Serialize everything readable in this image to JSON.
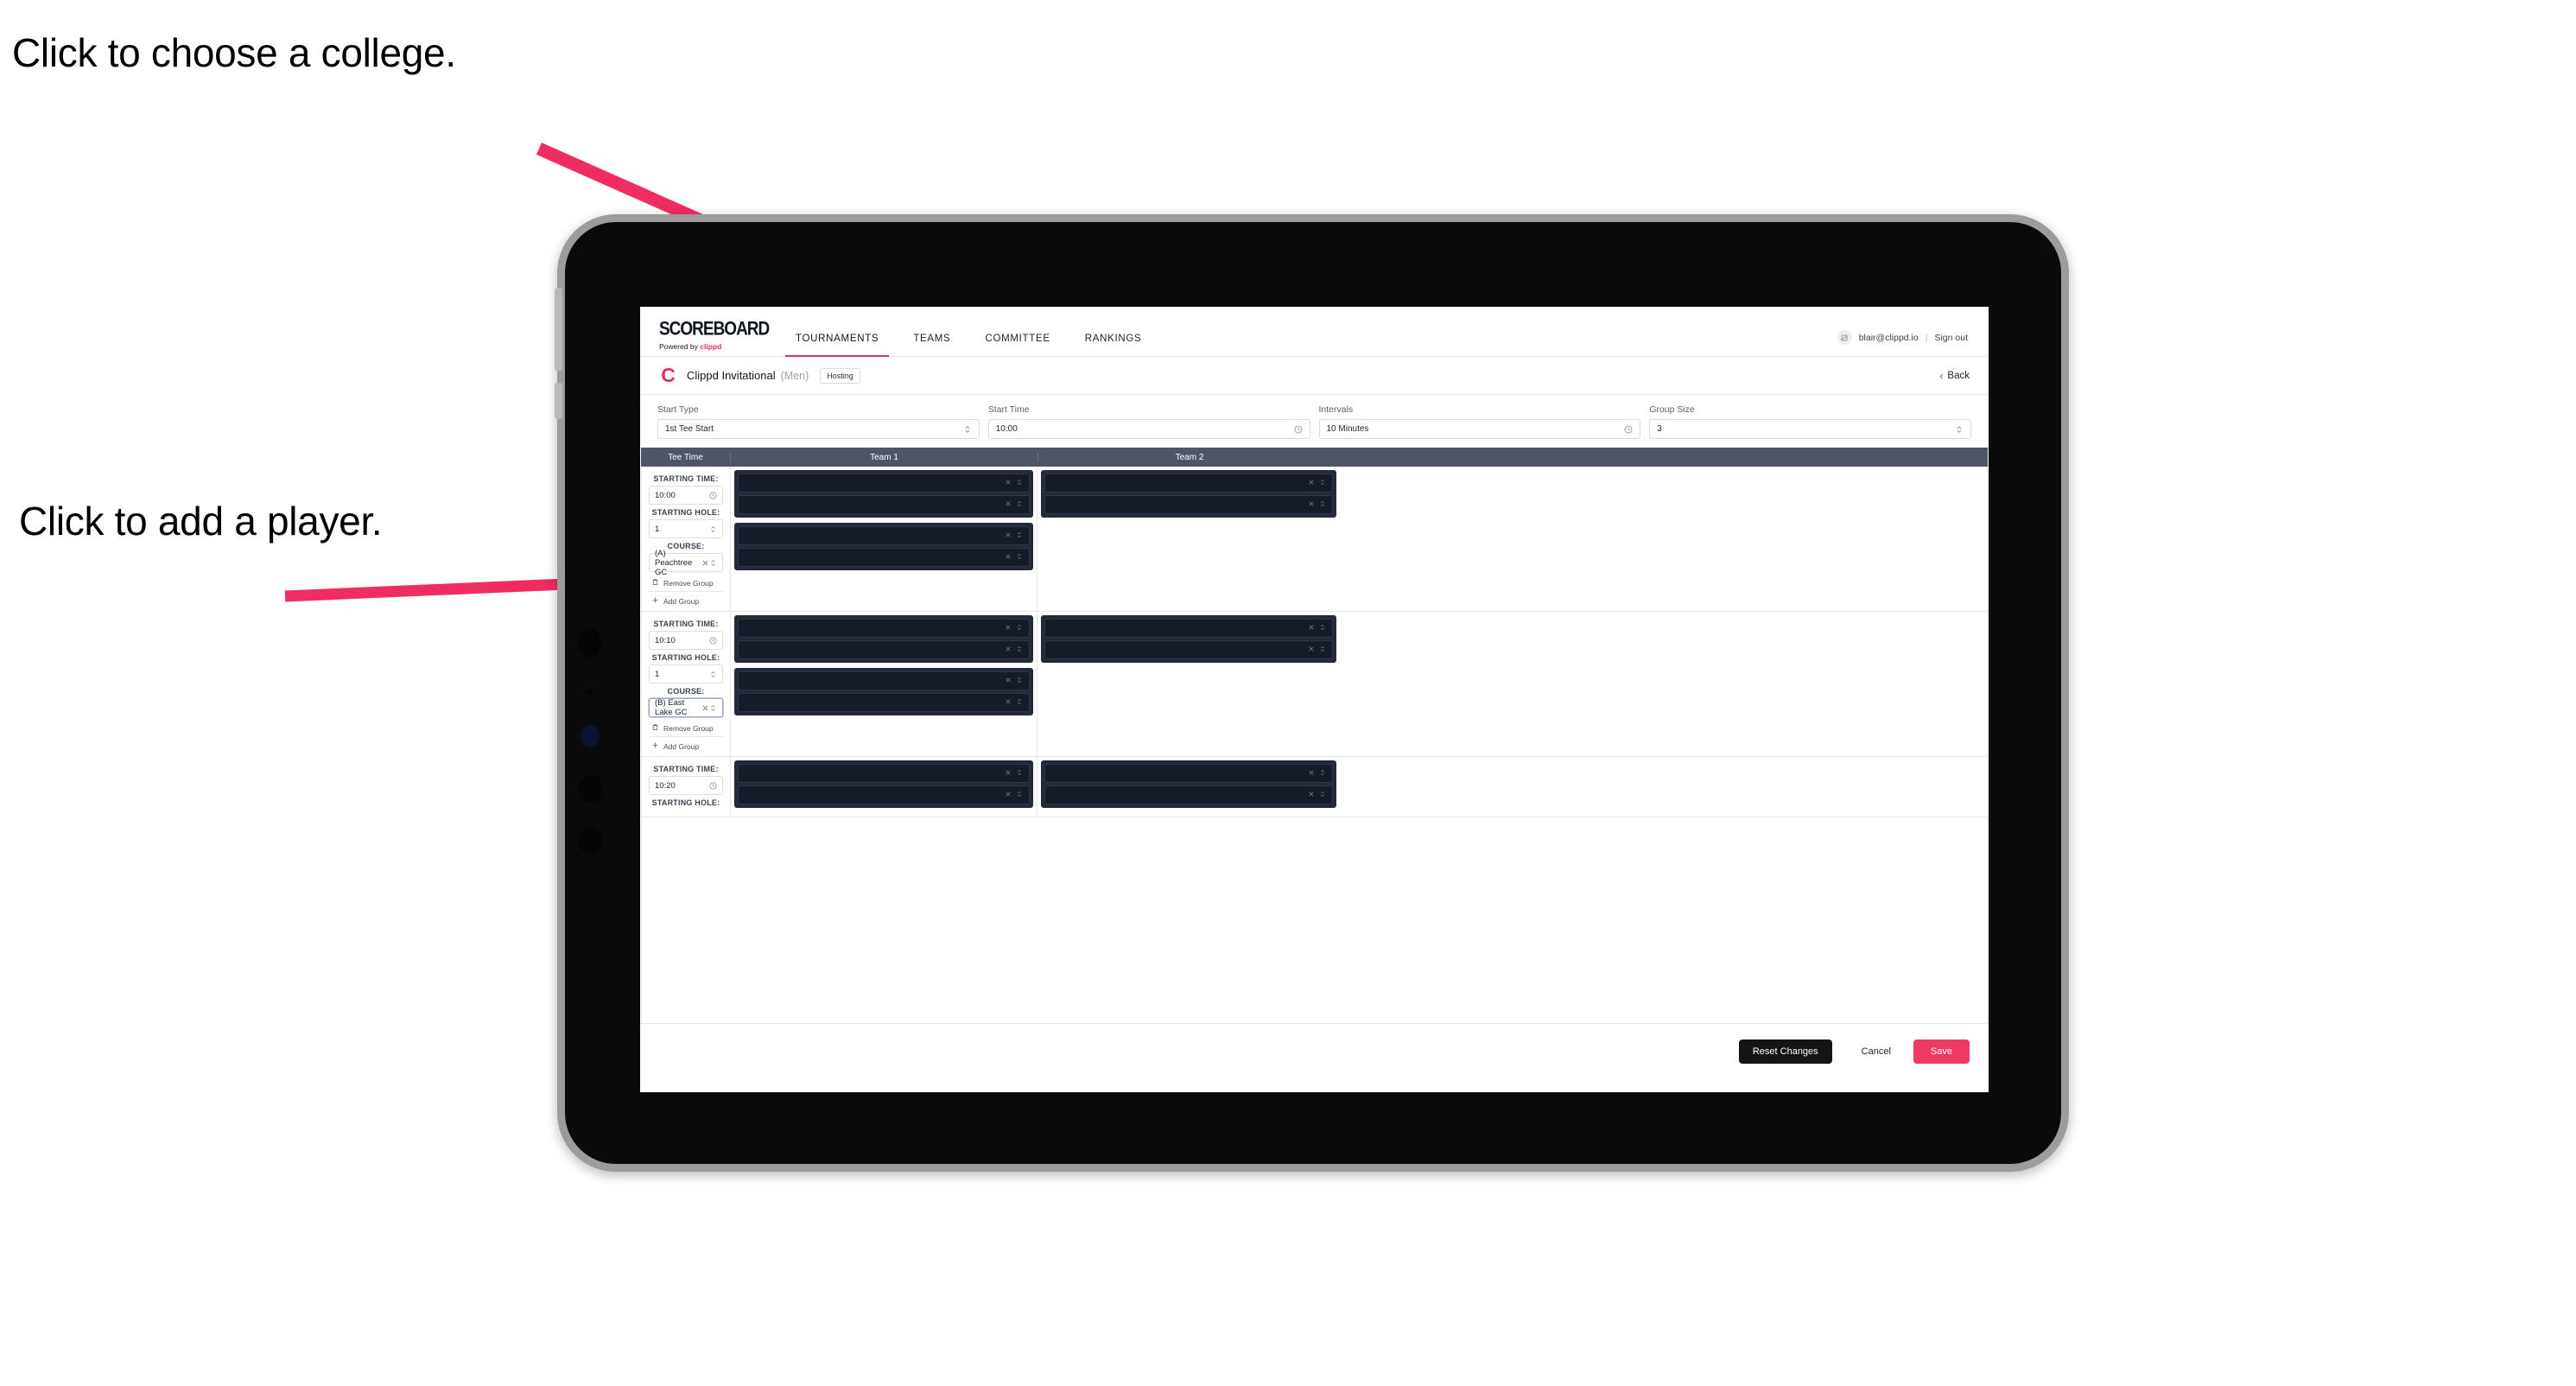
{
  "annotations": {
    "college": "Click to choose a college.",
    "player": "Click to add a player.",
    "arrow_color": "#ef2d63"
  },
  "app": {
    "brand": {
      "name": "SCOREBOARD",
      "tagline_prefix": "Powered by ",
      "tagline_brand": "clippd"
    },
    "nav": [
      {
        "label": "TOURNAMENTS",
        "active": true
      },
      {
        "label": "TEAMS",
        "active": false
      },
      {
        "label": "COMMITTEE",
        "active": false
      },
      {
        "label": "RANKINGS",
        "active": false
      }
    ],
    "user": {
      "email": "blair@clippd.io",
      "separator": "|",
      "sign_out": "Sign out"
    },
    "tournament": {
      "logo_letter": "C",
      "name": "Clippd Invitational",
      "gender": "(Men)",
      "role_badge": "Hosting",
      "back_label": "Back"
    },
    "filters": [
      {
        "label": "Start Type",
        "value": "1st Tee Start",
        "icon": "stepper-icon"
      },
      {
        "label": "Start Time",
        "value": "10:00",
        "icon": "clock-icon"
      },
      {
        "label": "Intervals",
        "value": "10 Minutes",
        "icon": "clock-icon"
      },
      {
        "label": "Group Size",
        "value": "3",
        "icon": "stepper-icon"
      }
    ],
    "table": {
      "columns": [
        "Tee Time",
        "Team 1",
        "Team 2"
      ],
      "field_labels": {
        "time": "STARTING TIME:",
        "hole": "STARTING HOLE:",
        "course": "COURSE:"
      },
      "group_actions": {
        "remove": "Remove Group",
        "add": "Add Group"
      },
      "rows": [
        {
          "time": "10:00",
          "hole": "1",
          "course": "(A) Peachtree GC",
          "course_focused": false,
          "team1_groups": [
            {
              "slots": 2
            },
            {
              "slots": 2
            }
          ],
          "team2_groups": [
            {
              "slots": 2
            }
          ]
        },
        {
          "time": "10:10",
          "hole": "1",
          "course": "(B) East Lake GC",
          "course_focused": true,
          "team1_groups": [
            {
              "slots": 2
            },
            {
              "slots": 2
            }
          ],
          "team2_groups": [
            {
              "slots": 2
            }
          ]
        },
        {
          "time": "10:20",
          "hole": "",
          "course": "",
          "course_focused": false,
          "team1_groups": [
            {
              "slots": 2
            }
          ],
          "team2_groups": [
            {
              "slots": 2
            }
          ]
        }
      ]
    },
    "footer": {
      "reset": "Reset Changes",
      "cancel": "Cancel",
      "save": "Save"
    }
  }
}
